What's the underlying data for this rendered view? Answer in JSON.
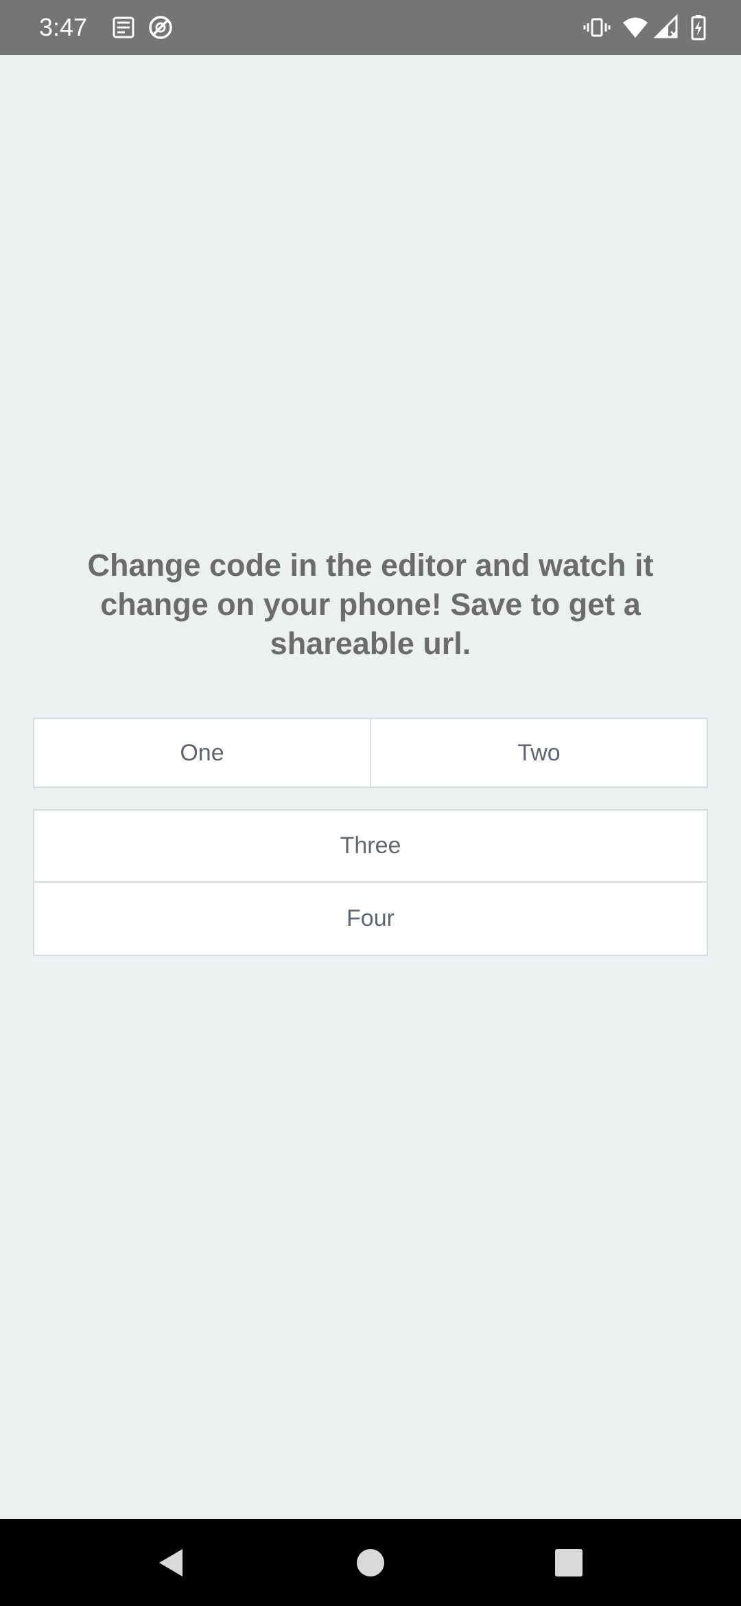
{
  "status_bar": {
    "time": "3:47",
    "icons": [
      "news-icon",
      "do-not-disturb-icon",
      "vibrate-icon",
      "wifi-icon",
      "signal-icon",
      "battery-charging-icon"
    ]
  },
  "main": {
    "message": "Change code in the editor and watch it change on your phone! Save to get a shareable url.",
    "buttons": {
      "one": "One",
      "two": "Two",
      "three": "Three",
      "four": "Four"
    }
  },
  "nav_bar": {
    "icons": [
      "back-icon",
      "home-icon",
      "recents-icon"
    ]
  },
  "colors": {
    "status_bar": "#757575",
    "background": "#ecf0f1",
    "text_heading": "#6b6b6b",
    "button_text": "#5e6770",
    "button_border": "#d6dbdd"
  }
}
